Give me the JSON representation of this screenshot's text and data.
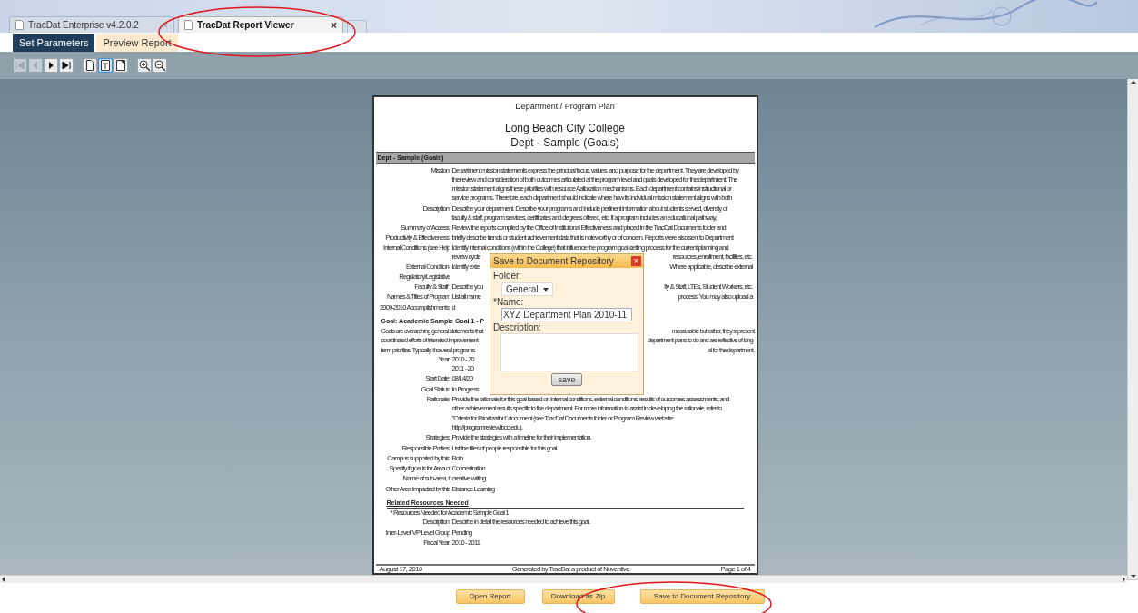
{
  "browser_tabs": [
    {
      "label": "TracDat Enterprise v4.2.0.2",
      "close": "×",
      "selected": false
    },
    {
      "label": "TracDat Report Viewer",
      "close": "×",
      "selected": true
    }
  ],
  "app_tabs": [
    {
      "label": "Set Parameters",
      "selected": false
    },
    {
      "label": "Preview Report",
      "selected": true
    }
  ],
  "toolbar": [
    {
      "kind": "first",
      "disabled": true,
      "selected": false
    },
    {
      "kind": "prev",
      "disabled": true,
      "selected": false
    },
    {
      "kind": "next",
      "disabled": false,
      "selected": false
    },
    {
      "kind": "last",
      "disabled": false,
      "selected": false
    },
    {
      "kind": "page",
      "disabled": false,
      "selected": false
    },
    {
      "kind": "page-width",
      "disabled": false,
      "selected": true
    },
    {
      "kind": "page-fit",
      "disabled": false,
      "selected": false
    },
    {
      "kind": "zoom-in",
      "disabled": false,
      "selected": false
    },
    {
      "kind": "zoom-out",
      "disabled": false,
      "selected": false
    }
  ],
  "report": {
    "titles": [
      "Department / Program Plan",
      "Long Beach City College",
      "Dept - Sample (Goals)"
    ],
    "band": "Dept - Sample (Goals)",
    "rows": [
      {
        "kind": "field",
        "label": [
          "Mission:"
        ],
        "lines": [
          "Department mission statements express the principal focus, values, and purpose for the department. They are developed by",
          "the review and consideration of both outcomes articulated at the program level and goals developed for the department. The",
          "mission statement aligns these priorities with resource Aallocation mechanisms. Each department contains instructional or",
          "service programs. Therefore, each department should indicate where how its individual mission statement aligns with both"
        ]
      },
      {
        "kind": "field",
        "label": [
          "Description:"
        ],
        "lines": [
          "Describe your department.  Describe your programs and include pertinent information about students served, diversity of",
          "faculty & staff, program services, certificates and degrees offered, etc. If a program includes an educational pathway,"
        ]
      },
      {
        "kind": "field",
        "label": [
          "Summary of Access,",
          "Productivity & Effectiveness:"
        ],
        "lines": [
          "Review the reports compiled by the Office of Institutional Effectiveness and placed in the TracDat Documents folder and",
          "briefly describe trends or student achievement data that is noteworthy or of concern.  Reports were also sent to Department"
        ]
      },
      {
        "kind": "field",
        "label": [
          "Internal Conditions (see Help"
        ],
        "lines": [
          "Identify internal conditions (within the College) that influence the program goal-setting process for the current planning and",
          {
            "left": "review cycle",
            "right": "resources, enrollment, facilities, etc."
          }
        ]
      },
      {
        "kind": "field",
        "label": [
          "External Condition-",
          "Regulatory/Legislative"
        ],
        "lines": [
          {
            "left": "Identify exte",
            "right": "Where applicable, describe external"
          }
        ]
      },
      {
        "kind": "field",
        "label": [
          "Faculty & Staff :"
        ],
        "lines": [
          {
            "left": "Describe you",
            "right": "lty & Staff, LTEs, Student Workers, etc."
          }
        ]
      },
      {
        "kind": "field",
        "label": [
          "Names & Titles of Program"
        ],
        "lines": [
          {
            "left": "List all name",
            "right": "process. You may also upload a"
          }
        ]
      },
      {
        "kind": "field",
        "label": [
          "2009-2010 Accomplishments:"
        ],
        "lines": [
          "d"
        ]
      },
      {
        "kind": "heading",
        "text": "Goal: Academic Sample Goal 1 - P"
      },
      {
        "kind": "para",
        "lines": [
          {
            "left": "Goals are overarching general statements that",
            "right": "measurable but rather, they represent"
          },
          {
            "left": "coordinated efforts of intended  improvement",
            "right": "department plans to do and are reflective of long-"
          },
          {
            "left": "term priorities. Typically, if several programs",
            "right": "al for the department."
          }
        ]
      },
      {
        "kind": "field",
        "label": [
          "Year:"
        ],
        "lines": [
          "2010 - 20",
          "2011 - 20"
        ]
      },
      {
        "kind": "field",
        "label": [
          "Start Date:"
        ],
        "lines": [
          "08/14/20"
        ]
      },
      {
        "kind": "field",
        "label": [
          "Goal Status:"
        ],
        "lines": [
          "In Progress"
        ]
      },
      {
        "kind": "field",
        "label": [
          "Rationale:"
        ],
        "lines": [
          "Provide the rationale for this goal based on internal conditions, external conditions, results of outcomes assessments, and",
          "other achievement results specific to the department. For more information to assist in developing the rationale, refer to",
          "\"Criteria for Prioritization\" document (see TracDat Documents folder or Program Review website:",
          "http://programreview.lbcc.edu)."
        ]
      },
      {
        "kind": "field",
        "label": [
          "Strategies:"
        ],
        "lines": [
          "Provide the strategies with a timeline for their implementation."
        ]
      },
      {
        "kind": "field",
        "label": [
          "Responsible Parties:"
        ],
        "lines": [
          "List the titles of people responsible for this goal."
        ]
      },
      {
        "kind": "field",
        "label": [
          "Campus supported by this:"
        ],
        "lines": [
          "Both"
        ]
      },
      {
        "kind": "field",
        "label": [
          "Specify if goal is for Area of"
        ],
        "lines": [
          "Concentration"
        ]
      },
      {
        "kind": "field",
        "label": [
          "Name of sub-area, if"
        ],
        "lines": [
          "creative writing"
        ]
      },
      {
        "kind": "field",
        "label": [
          "Other Area Impacted by this"
        ],
        "lines": [
          "Distance Learning"
        ]
      },
      {
        "kind": "section",
        "text": "Related Resources Needed"
      },
      {
        "kind": "plain",
        "text": "* Resources Needed for Academic Sample Goal 1"
      },
      {
        "kind": "field",
        "label": [
          "Description:"
        ],
        "lines": [
          "Describe in detail the resources needed to achieve this goal."
        ]
      },
      {
        "kind": "field",
        "label": [
          "Inter-Level/ VP Level Group"
        ],
        "lines": [
          "Pending"
        ]
      },
      {
        "kind": "field",
        "label": [
          "Fiscal Year:"
        ],
        "lines": [
          "2010 - 2011"
        ]
      }
    ],
    "footer": [
      "August 17, 2010",
      "Generated by TracDat a product of Nuventive.",
      "Page 1 of 4"
    ]
  },
  "dialog": {
    "title": "Save to Document Repository",
    "close": "×",
    "folder_label": "Folder:",
    "folder_value": "General",
    "name_label": "*Name:",
    "name_value": "XYZ Department Plan 2010-11",
    "description_label": "Description:",
    "save": "save"
  },
  "buttons": [
    "Open Report",
    "Download as Zip",
    "Save to Document Repository"
  ]
}
